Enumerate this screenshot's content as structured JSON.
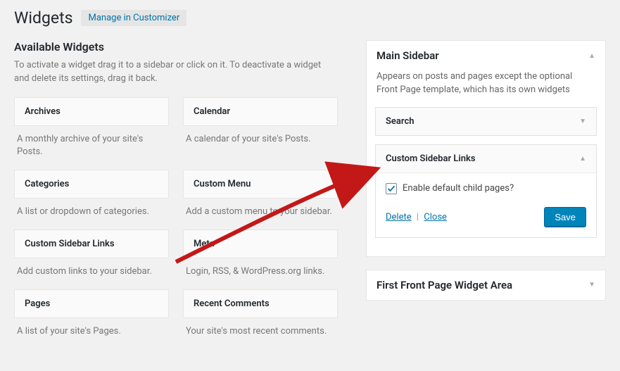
{
  "header": {
    "title": "Widgets",
    "manage_link": "Manage in Customizer"
  },
  "available": {
    "title": "Available Widgets",
    "desc": "To activate a widget drag it to a sidebar or click on it. To deactivate a widget and delete its settings, drag it back.",
    "widgets": [
      {
        "name": "Archives",
        "desc": "A monthly archive of your site's Posts."
      },
      {
        "name": "Calendar",
        "desc": "A calendar of your site's Posts."
      },
      {
        "name": "Categories",
        "desc": "A list or dropdown of categories."
      },
      {
        "name": "Custom Menu",
        "desc": "Add a custom menu to your sidebar."
      },
      {
        "name": "Custom Sidebar Links",
        "desc": "Add custom links to your sidebar."
      },
      {
        "name": "Meta",
        "desc": "Login, RSS, & WordPress.org links."
      },
      {
        "name": "Pages",
        "desc": "A list of your site's Pages."
      },
      {
        "name": "Recent Comments",
        "desc": "Your site's most recent comments."
      }
    ]
  },
  "areas": {
    "main_sidebar": {
      "title": "Main Sidebar",
      "desc": "Appears on posts and pages except the optional Front Page template, which has its own widgets",
      "search_widget": "Search",
      "custom_links_widget": {
        "title": "Custom Sidebar Links",
        "checkbox_label": "Enable default child pages?",
        "delete": "Delete",
        "close": "Close",
        "save": "Save"
      }
    },
    "first_front": {
      "title": "First Front Page Widget Area"
    }
  }
}
